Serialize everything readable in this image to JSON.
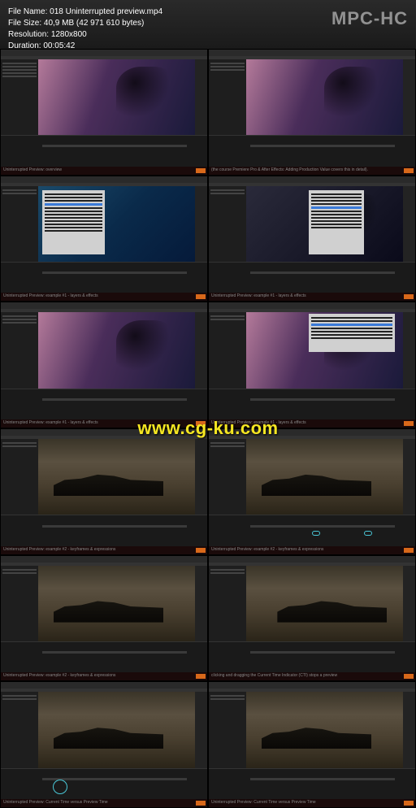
{
  "app": {
    "name": "MPC-HC"
  },
  "file": {
    "name_label": "File Name:",
    "name": "018 Uninterrupted preview.mp4",
    "size_label": "File Size:",
    "size": "40,9 MB (42 971 610 bytes)",
    "res_label": "Resolution:",
    "resolution": "1280x800",
    "dur_label": "Duration:",
    "duration": "00:05:42"
  },
  "watermark": "www.cg-ku.com",
  "captions": {
    "c1": "Uninterrupted Preview: overview",
    "c2": "(the course Premiere Pro & After Effects: Adding Production Value covers this in detail).",
    "c3": "Uninterrupted Preview: example #1 - layers & effects",
    "c4": "Uninterrupted Preview: example #1 - layers & effects",
    "c5": "Uninterrupted Preview: example #1 - layers & effects",
    "c6": "Uninterrupted Preview: example #1 - layers & effects",
    "c7": "Uninterrupted Preview: example #2 - keyframes & expressions",
    "c8": "Uninterrupted Preview: example #2 - keyframes & expressions",
    "c9": "Uninterrupted Preview: example #2 - keyframes & expressions",
    "c10": "clicking and dragging the Current Time Indicator (CTI) stops a preview",
    "c11": "Uninterrupted Preview: Current Time versus Preview Time",
    "c12": "Uninterrupted Preview: Current Time versus Preview Time"
  }
}
